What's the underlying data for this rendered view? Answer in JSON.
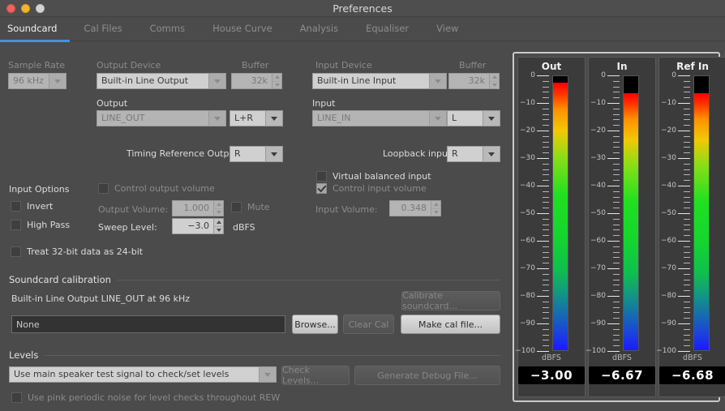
{
  "window": {
    "title": "Preferences"
  },
  "tabs": [
    {
      "label": "Soundcard",
      "active": true
    },
    {
      "label": "Cal Files",
      "active": false
    },
    {
      "label": "Comms",
      "active": false
    },
    {
      "label": "House Curve",
      "active": false
    },
    {
      "label": "Analysis",
      "active": false
    },
    {
      "label": "Equaliser",
      "active": false
    },
    {
      "label": "View",
      "active": false
    }
  ],
  "soundcard": {
    "sample_rate_label": "Sample Rate",
    "sample_rate_value": "96 kHz",
    "output_device_label": "Output Device",
    "output_device_value": "Built-in Line Output",
    "output_buffer_label": "Buffer",
    "output_buffer_value": "32k",
    "output_label": "Output",
    "output_value": "LINE_OUT",
    "output_channel_value": "L+R",
    "timing_reference_label": "Timing Reference Output",
    "timing_reference_value": "R",
    "input_device_label": "Input Device",
    "input_device_value": "Built-in Line Input",
    "input_buffer_label": "Buffer",
    "input_buffer_value": "32k",
    "input_label": "Input",
    "input_value": "LINE_IN",
    "input_channel_value": "L",
    "virtual_balanced_label": "Virtual balanced input",
    "virtual_balanced_checked": false,
    "loopback_label": "Loopback input",
    "loopback_value": "R",
    "input_options_label": "Input Options",
    "invert_label": "Invert",
    "invert_checked": false,
    "high_pass_label": "High Pass",
    "high_pass_checked": false,
    "treat32_label": "Treat 32-bit data as 24-bit",
    "treat32_checked": false,
    "control_output_volume_label": "Control output volume",
    "control_output_volume_checked": false,
    "output_volume_label": "Output Volume:",
    "output_volume_value": "1.000",
    "mute_label": "Mute",
    "mute_checked": false,
    "sweep_level_label": "Sweep Level:",
    "sweep_level_value": "-3.0",
    "sweep_level_units": "dBFS",
    "control_input_volume_label": "Control input volume",
    "control_input_volume_checked": true,
    "input_volume_label": "Input Volume:",
    "input_volume_value": "0.348"
  },
  "calibration": {
    "section_label": "Soundcard calibration",
    "device_line": "Built-in Line Output LINE_OUT at 96 kHz",
    "cal_file_value": "None",
    "calibrate_button": "Calibrate soundcard...",
    "browse_button": "Browse...",
    "clear_button": "Clear Cal",
    "make_cal_button": "Make cal file..."
  },
  "levels": {
    "section_label": "Levels",
    "select_value": "Use main speaker test signal to check/set levels",
    "check_levels_button": "Check Levels...",
    "debug_file_button": "Generate Debug File...",
    "pink_noise_label": "Use pink periodic noise for level checks throughout REW",
    "pink_noise_checked": false
  },
  "meters": {
    "units": "dBFS",
    "scale_min": -100,
    "scale_max": 0,
    "major_ticks": [
      0,
      -10,
      -20,
      -30,
      -40,
      -50,
      -60,
      -70,
      -80,
      -90,
      -100
    ],
    "minor_tick_step": 2,
    "channels": [
      {
        "title": "Out",
        "value": "-3.00",
        "level_db": -3.0
      },
      {
        "title": "In",
        "value": "-6.67",
        "level_db": -6.67
      },
      {
        "title": "Ref In",
        "value": "-6.68",
        "level_db": -6.68
      }
    ]
  }
}
